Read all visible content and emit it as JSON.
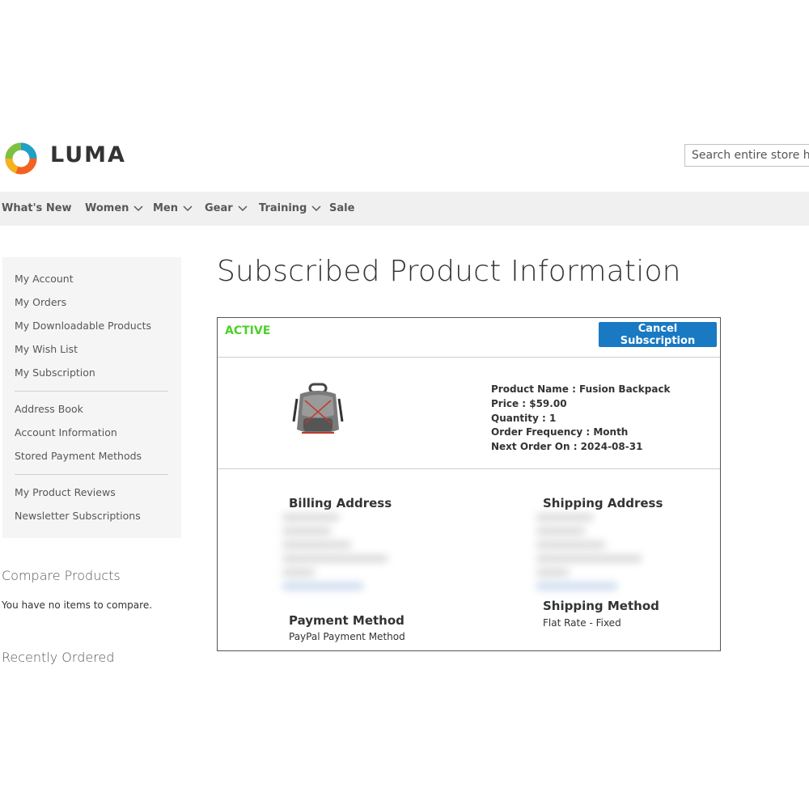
{
  "header": {
    "brand": "LUMA",
    "search_placeholder": "Search entire store here..."
  },
  "nav": {
    "items": [
      {
        "label": "What's New"
      },
      {
        "label": "Women"
      },
      {
        "label": "Men"
      },
      {
        "label": "Gear"
      },
      {
        "label": "Training"
      },
      {
        "label": "Sale"
      }
    ]
  },
  "sidebar": {
    "groups": [
      [
        "My Account",
        "My Orders",
        "My Downloadable Products",
        "My Wish List",
        "My Subscription"
      ],
      [
        "Address Book",
        "Account Information",
        "Stored Payment Methods"
      ],
      [
        "My Product Reviews",
        "Newsletter Subscriptions"
      ]
    ]
  },
  "compare": {
    "title": "Compare Products",
    "empty_text": "You have no items to compare."
  },
  "recently_ordered": {
    "title": "Recently Ordered"
  },
  "main": {
    "title": "Subscribed Product Information",
    "status": "ACTIVE",
    "cancel_label": "Cancel Subscription",
    "product": {
      "name_line": "Product Name : Fusion Backpack",
      "price_line": "Price : $59.00",
      "quantity_line": "Quantity : 1",
      "frequency_line": "Order Frequency : Month",
      "next_order_line": "Next Order On : 2024-08-31"
    },
    "billing_title": "Billing Address",
    "shipping_title": "Shipping Address",
    "payment_title": "Payment Method",
    "payment_value": "PayPal Payment Method",
    "shipping_method_title": "Shipping Method",
    "shipping_method_value": "Flat Rate - Fixed"
  },
  "colors": {
    "accent": "#1979c3",
    "status_active": "#4cd02a",
    "nav_bg": "#f0f0f0",
    "sidebar_bg": "#f5f5f5"
  }
}
